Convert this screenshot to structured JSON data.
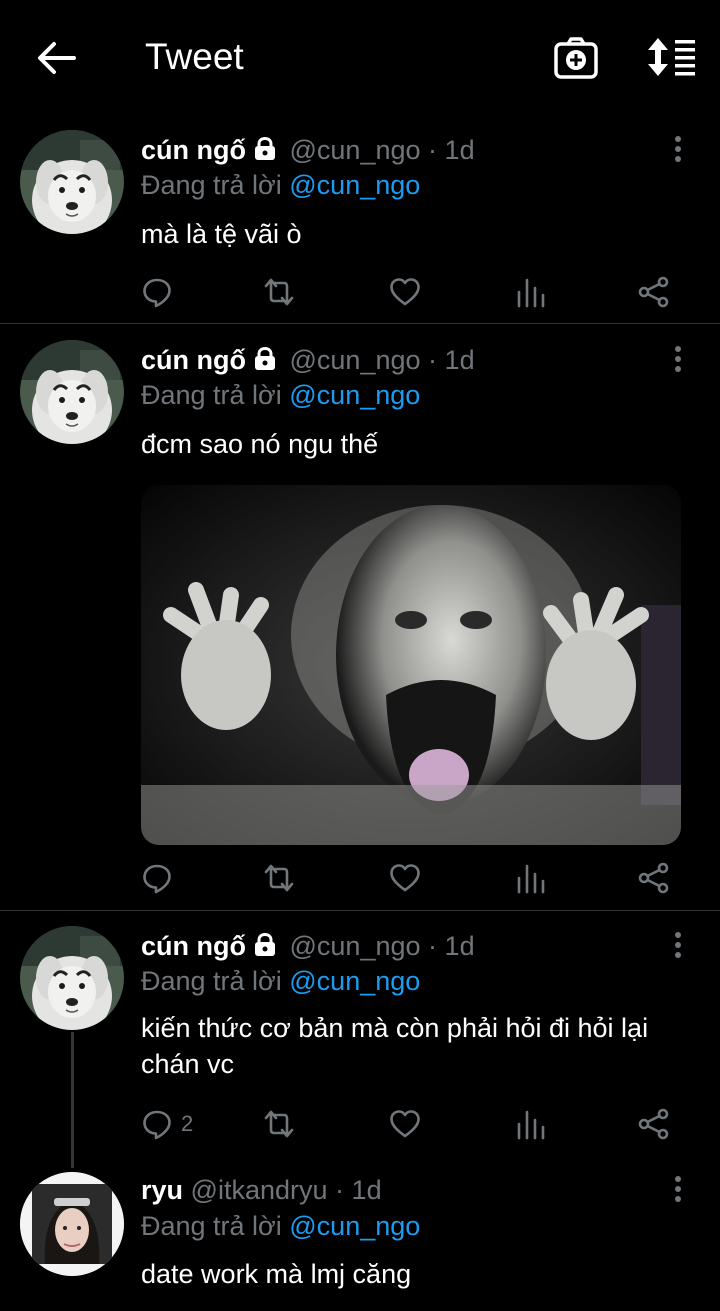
{
  "header": {
    "title": "Tweet",
    "back_icon": "arrow-left-icon",
    "camera_icon": "camera-add-icon",
    "sort_icon": "sort-icon"
  },
  "colors": {
    "background": "#000000",
    "text": "#ffffff",
    "muted": "#71767b",
    "link": "#1d9bf0",
    "divider": "#2f3336"
  },
  "tweets": [
    {
      "name": "cún ngố",
      "protected": true,
      "handle": "@cun_ngo",
      "separator": "·",
      "time": "1d",
      "replying_label": "Đang trả lời ",
      "replying_to": "@cun_ngo",
      "text": "mà là tệ vãi ò",
      "reply_count": ""
    },
    {
      "name": "cún ngố",
      "protected": true,
      "handle": "@cun_ngo",
      "separator": "·",
      "time": "1d",
      "replying_label": "Đang trả lời ",
      "replying_to": "@cun_ngo",
      "text": "đcm sao nó ngu thế",
      "reply_count": "",
      "has_media": true
    },
    {
      "name": "cún ngố",
      "protected": true,
      "handle": "@cun_ngo",
      "separator": "·",
      "time": "1d",
      "replying_label": "Đang trả lời ",
      "replying_to": "@cun_ngo",
      "text": "kiến thức cơ bản mà còn phải hỏi đi hỏi lại chán vc",
      "reply_count": "2"
    },
    {
      "name": "ryu",
      "protected": false,
      "handle": "@itkandryu",
      "separator": "·",
      "time": "1d",
      "replying_label": "Đang trả lời ",
      "replying_to": "@cun_ngo",
      "text": "date work mà lmj căng"
    }
  ],
  "action_icons": [
    "reply-icon",
    "retweet-icon",
    "like-icon",
    "analytics-icon",
    "share-icon"
  ]
}
